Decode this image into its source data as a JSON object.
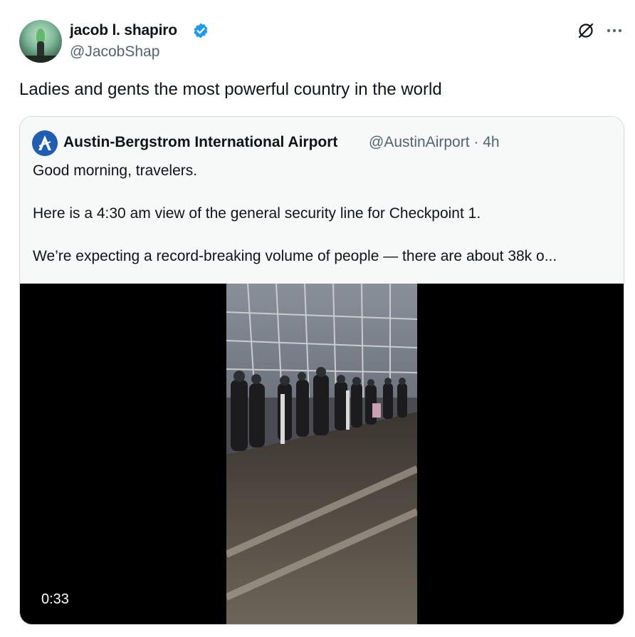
{
  "tweet": {
    "author_name": "jacob l. shapiro",
    "author_handle": "@JacobShap",
    "text": "Ladies and gents the most powerful country in the world",
    "verified_color": "#1d9bf0"
  },
  "quote": {
    "author_name": "Austin-Bergstrom International Airport",
    "author_handle_time": "@AustinAirport · 4h",
    "lines": [
      "Good morning, travelers.",
      "Here is a 4:30 am view of the general security line for Checkpoint 1.",
      "We’re expecting a record-breaking volume of people — there are about 38k o..."
    ]
  },
  "video": {
    "duration": "0:33"
  },
  "icons": {
    "avatar": "avatar-photo",
    "verified": "verified-badge-icon",
    "grok": "grok-icon",
    "more": "more-options-icon",
    "airport_logo": "airport-logo-icon"
  }
}
